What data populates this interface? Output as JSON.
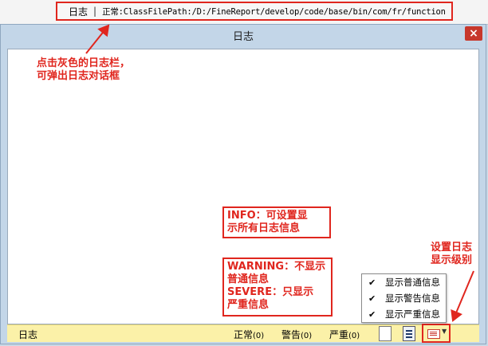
{
  "top_bar": {
    "log_label": "日志",
    "separator": "|",
    "log_text": "正常:ClassFilePath:/D:/FineReport/develop/code/base/bin/com/fr/function"
  },
  "dialog": {
    "title": "日志",
    "close_glyph": "×"
  },
  "status_bar": {
    "log_label": "日志",
    "normal_label": "正常",
    "normal_count": "(0)",
    "warning_label": "警告",
    "warning_count": "(0)",
    "severe_label": "严重",
    "severe_count": "(0)"
  },
  "level_menu": {
    "items": [
      {
        "label": "显示普通信息",
        "checked": true
      },
      {
        "label": "显示警告信息",
        "checked": true
      },
      {
        "label": "显示严重信息",
        "checked": true
      }
    ]
  },
  "annotations": {
    "click_log_bar": [
      "点击灰色的日志栏，",
      "可弹出日志对话框"
    ],
    "info_note": [
      "INFO：可设置显",
      "示所有日志信息"
    ],
    "warning_note": [
      "WARNING：不显示",
      "普通信息",
      "SEVERE：只显示",
      "严重信息"
    ],
    "level_note": [
      "设置日志",
      "显示级别"
    ]
  },
  "icons": {
    "close": "close-icon",
    "check": "checkmark-icon",
    "clear": "document-icon",
    "list": "list-icon",
    "level": "log-level-icon",
    "dropdown": "chevron-down-icon"
  },
  "colors": {
    "annotation_red": "#e0261e",
    "status_bar_yellow": "#fbf1a8",
    "dialog_frame_blue": "#c3d6e8",
    "close_button_red": "#c7372b"
  }
}
